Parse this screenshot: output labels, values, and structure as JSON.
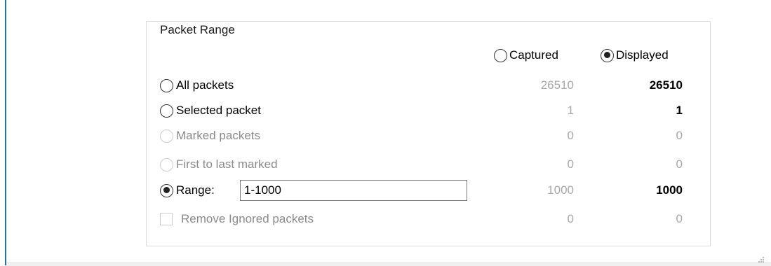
{
  "group": {
    "title": "Packet Range"
  },
  "columns": {
    "captured": "Captured",
    "displayed": "Displayed",
    "selected": "displayed"
  },
  "rows": [
    {
      "label": "All packets",
      "control": "radio",
      "checked": false,
      "enabled": true,
      "captured": "26510",
      "displayed": "26510"
    },
    {
      "label": "Selected packet",
      "control": "radio",
      "checked": false,
      "enabled": true,
      "captured": "1",
      "displayed": "1"
    },
    {
      "label": "Marked packets",
      "control": "radio",
      "checked": false,
      "enabled": false,
      "captured": "0",
      "displayed": "0"
    },
    {
      "label": "First to last marked",
      "control": "radio",
      "checked": false,
      "enabled": false,
      "captured": "0",
      "displayed": "0"
    },
    {
      "label": "Range:",
      "control": "radio",
      "checked": true,
      "enabled": true,
      "captured": "1000",
      "displayed": "1000"
    },
    {
      "label": "Remove Ignored packets",
      "control": "checkbox",
      "checked": false,
      "enabled": false,
      "captured": "0",
      "displayed": "0"
    }
  ],
  "range_input": {
    "value": "1-1000"
  }
}
